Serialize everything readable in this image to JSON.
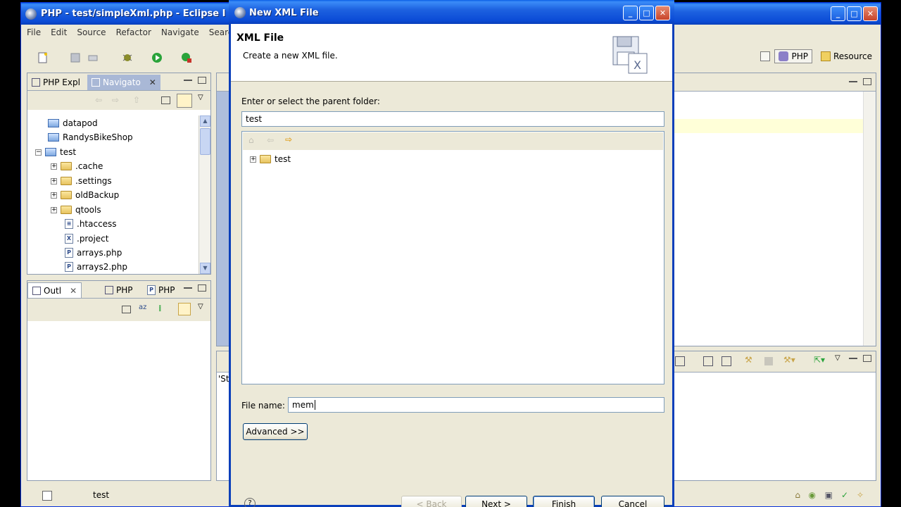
{
  "eclipse": {
    "title": "PHP - test/simpleXml.php - Eclipse I",
    "menu": [
      "File",
      "Edit",
      "Source",
      "Refactor",
      "Navigate",
      "Searc"
    ],
    "perspectives": [
      {
        "label": "PHP",
        "active": true
      },
      {
        "label": "Resource",
        "active": false
      }
    ],
    "left_tabs": {
      "php_explorer": "PHP Expl",
      "navigator": "Navigato"
    },
    "navigator_tree": [
      {
        "label": "datapod",
        "type": "project",
        "expander": ""
      },
      {
        "label": "RandysBikeShop",
        "type": "project",
        "expander": ""
      },
      {
        "label": "test",
        "type": "project-open",
        "expander": "minus"
      },
      {
        "label": ".cache",
        "type": "folder",
        "expander": "plus"
      },
      {
        "label": ".settings",
        "type": "folder",
        "expander": "plus"
      },
      {
        "label": "oldBackup",
        "type": "folder",
        "expander": "plus"
      },
      {
        "label": "qtools",
        "type": "folder",
        "expander": "plus"
      },
      {
        "label": ".htaccess",
        "type": "file",
        "expander": ""
      },
      {
        "label": ".project",
        "type": "xml-file",
        "expander": ""
      },
      {
        "label": "arrays.php",
        "type": "php-file",
        "expander": ""
      },
      {
        "label": "arrays2.php",
        "type": "php-file",
        "expander": ""
      }
    ],
    "outline_tabs": {
      "outline": "Outl",
      "php1": "PHP",
      "php2": "PHP"
    },
    "console_partial": "'St",
    "status_text": "test"
  },
  "dialog": {
    "title": "New XML File",
    "header_title": "XML File",
    "header_description": "Create a new XML file.",
    "parent_folder_label": "Enter or select the parent folder:",
    "parent_folder_value": "test",
    "folder_tree": [
      {
        "label": "test",
        "expander": "plus"
      }
    ],
    "file_name_label": "File name:",
    "file_name_value": "mem",
    "advanced_button": "Advanced >>",
    "buttons": {
      "back": "< Back",
      "next": "Next >",
      "finish": "Finish",
      "cancel": "Cancel"
    }
  }
}
